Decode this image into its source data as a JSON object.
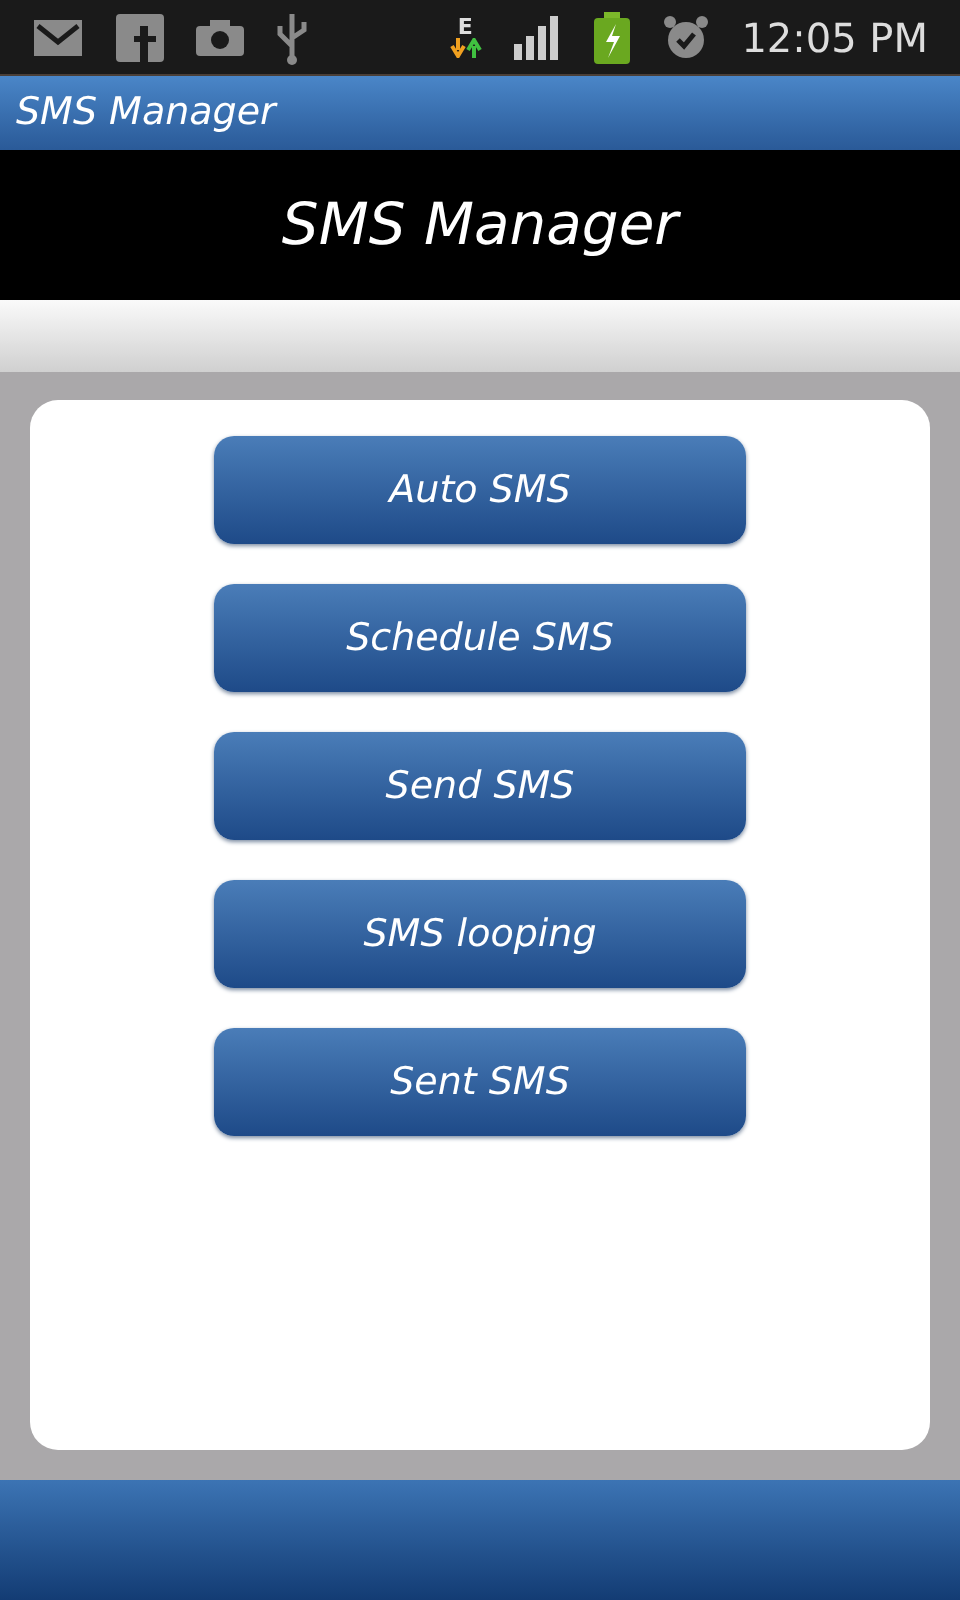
{
  "status_bar": {
    "network_type": "E",
    "time": "12:05 PM"
  },
  "title_bar": {
    "title": "SMS Manager"
  },
  "header": {
    "title": "SMS Manager"
  },
  "menu": [
    {
      "label": "Auto SMS"
    },
    {
      "label": "Schedule SMS"
    },
    {
      "label": "Send SMS"
    },
    {
      "label": "SMS looping"
    },
    {
      "label": "Sent SMS"
    }
  ]
}
